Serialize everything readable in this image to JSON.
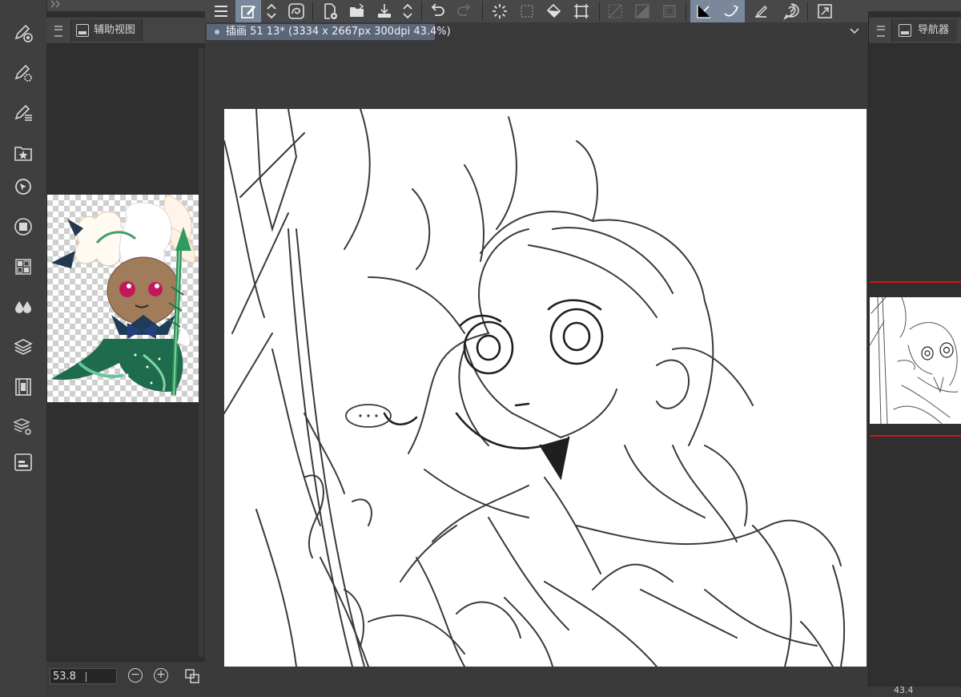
{
  "app": {
    "document_tab": "插画 51 13* (3334 x 2667px 300dpi 43.4%)"
  },
  "left_panel": {
    "tab_label": "辅助视图",
    "zoom_value": "53.8",
    "zoom_out_label": "−",
    "zoom_in_label": "+"
  },
  "right_panel": {
    "tab_label": "导航器",
    "zoom_value": "43.4"
  },
  "icons": {
    "top_toolbar": [
      "menu-icon",
      "edit-pen-icon",
      "stepper-icon",
      "lasso-icon",
      "new-layer-icon",
      "open-folder-icon",
      "export-icon",
      "stepper-icon",
      "undo-icon",
      "redo-icon",
      "loading-icon",
      "transform-selection-icon",
      "fill-icon",
      "crop-icon",
      "clear-selection-icon",
      "invert-selection-icon",
      "selection-border-icon",
      "draw-line-icon",
      "draw-curve-icon",
      "ruler-pen-icon",
      "help-bubble-icon",
      "fullscreen-icon"
    ],
    "left_toolbar": [
      "brush-target-icon",
      "brush-gear-icon",
      "brush-list-icon",
      "star-folder-icon",
      "cursor-circle-icon",
      "square-layer-icon",
      "color-grid-icon",
      "color-drops-icon",
      "layers-icon",
      "filmstrip-icon",
      "layer-props-icon",
      "panel-layout-icon"
    ]
  },
  "colors": {
    "accent": "#7a889c",
    "doc_tab": "#5b6679",
    "nav_frame": "#d21414"
  }
}
